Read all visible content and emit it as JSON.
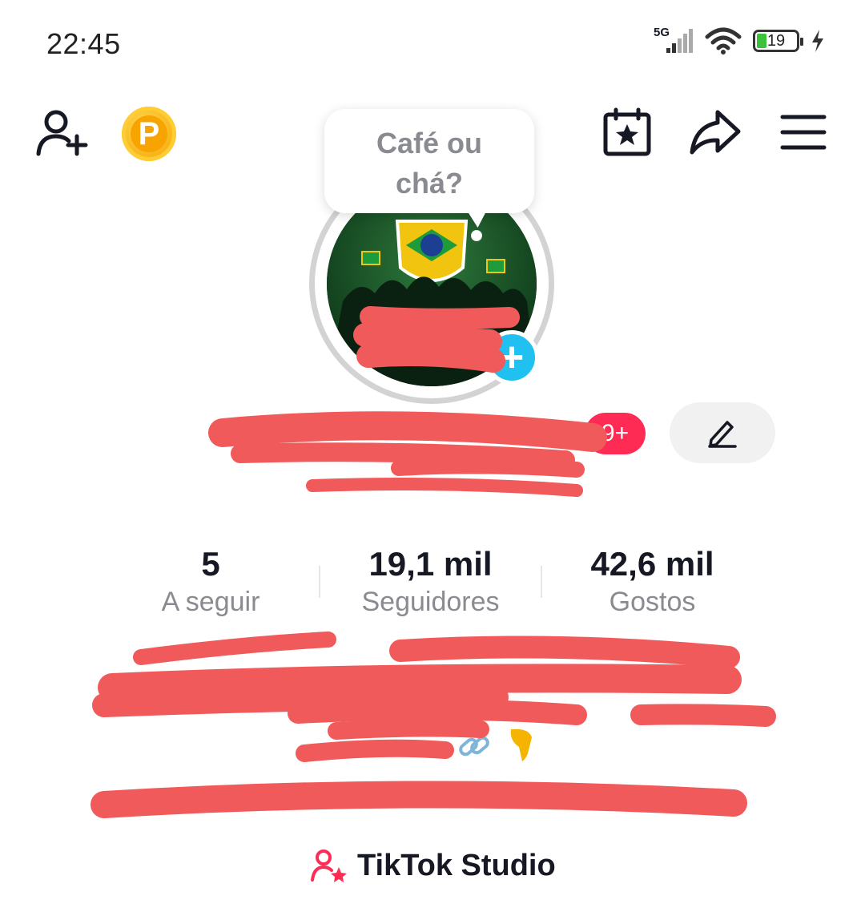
{
  "status_bar": {
    "time": "22:45",
    "network": "5G",
    "battery": "19"
  },
  "top_bar": {
    "icons": [
      "add-friend-icon",
      "coin-icon",
      "calendar-star-icon",
      "share-icon",
      "menu-icon"
    ],
    "coin_letter": "P"
  },
  "bubble": {
    "line1": "Café ou",
    "line2": "chá?"
  },
  "profile": {
    "notification_badge": "9+"
  },
  "stats": [
    {
      "value": "5",
      "label": "A seguir"
    },
    {
      "value": "19,1 mil",
      "label": "Seguidores"
    },
    {
      "value": "42,6 mil",
      "label": "Gostos"
    }
  ],
  "studio": {
    "label": "TikTok Studio"
  },
  "colors": {
    "accent": "#fe2c55",
    "plus_badge": "#20c0f0",
    "coin": "#f7a400",
    "redaction": "#f05a5a"
  }
}
